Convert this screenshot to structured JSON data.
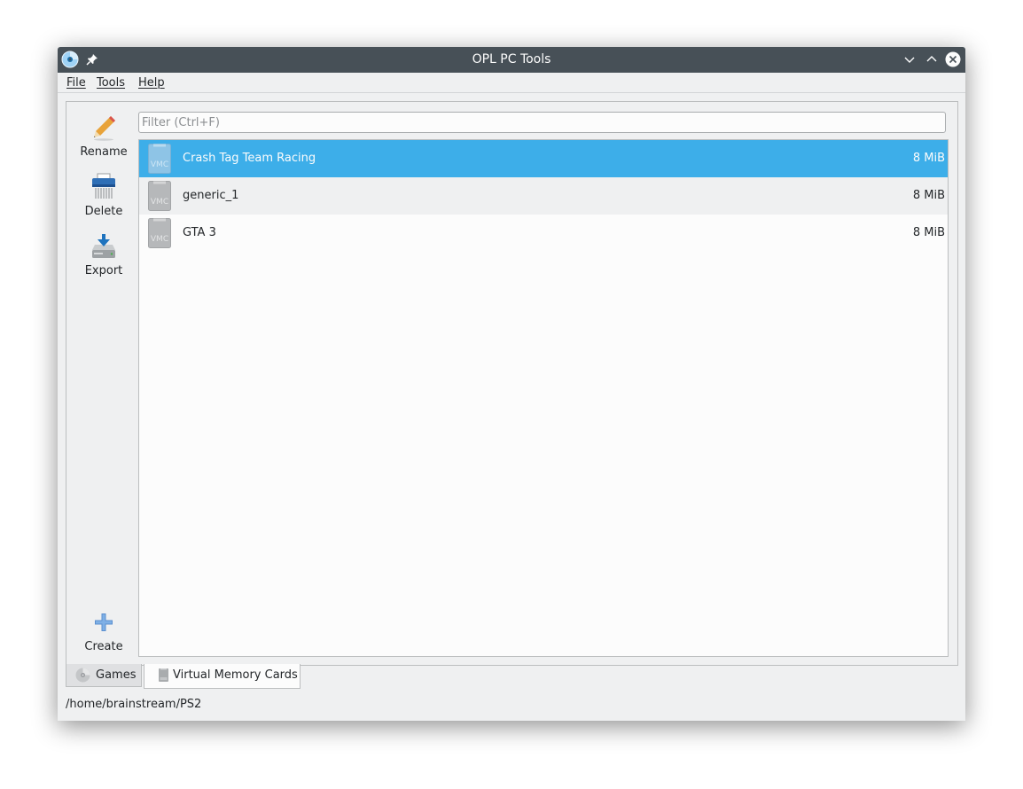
{
  "window": {
    "title": "OPL PC Tools"
  },
  "menu": {
    "file": "File",
    "tools": "Tools",
    "help": "Help"
  },
  "toolbar": {
    "rename": "Rename",
    "delete": "Delete",
    "export": "Export",
    "create": "Create"
  },
  "filter": {
    "placeholder": "Filter (Ctrl+F)",
    "value": ""
  },
  "cards": [
    {
      "name": "Crash Tag Team Racing",
      "size": "8 MiB",
      "icon": "vmc-icon",
      "selected": true
    },
    {
      "name": "generic_1",
      "size": "8 MiB",
      "icon": "vmc-icon",
      "selected": false
    },
    {
      "name": "GTA 3",
      "size": "8 MiB",
      "icon": "vmc-icon",
      "selected": false
    }
  ],
  "vmc_icon_text": "VMC",
  "tabs": [
    {
      "label": "Games",
      "icon": "disc-icon",
      "active": false
    },
    {
      "label": "Virtual Memory Cards",
      "icon": "memory-card-icon",
      "active": true
    }
  ],
  "status": {
    "path": "/home/brainstream/PS2"
  },
  "colors": {
    "titlebar": "#475057",
    "window_bg": "#eff0f1",
    "selection": "#3daee9",
    "list_bg": "#fcfcfc"
  }
}
